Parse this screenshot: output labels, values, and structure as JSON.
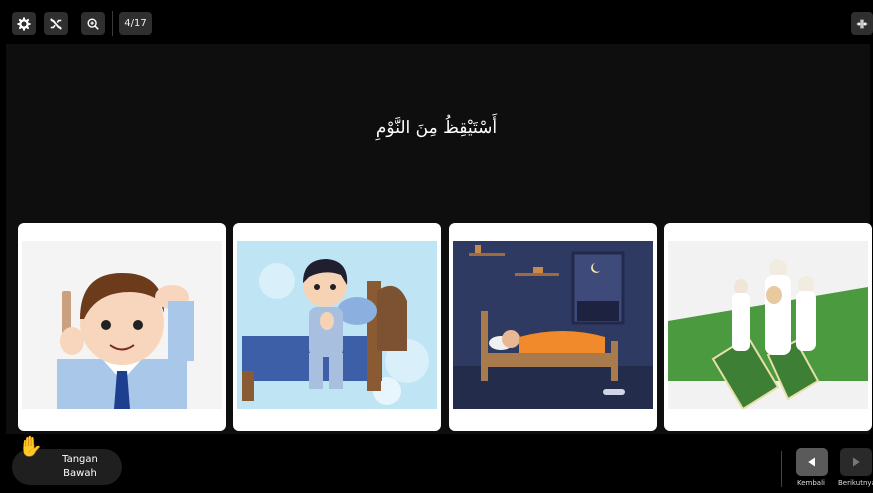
{
  "toolbar": {
    "settings_icon": "gear-icon",
    "shuffle_icon": "shuffle-off-icon",
    "zoom_icon": "zoom-in-icon",
    "slide_counter": "4/17",
    "collapse_icon": "collapse-icon"
  },
  "question": {
    "text": "أَسْتَيْقِظُ مِنَ النَّوْمِ"
  },
  "answer_cards": [
    {
      "image": "boy-combing-hair"
    },
    {
      "image": "boy-praying-on-bed"
    },
    {
      "image": "boy-sleeping-in-bed"
    },
    {
      "image": "family-praying-on-mats"
    }
  ],
  "raise_hand": {
    "icon": "raised-hand-icon",
    "label": "Tangan Bawah"
  },
  "navigation": {
    "back_label": "Kembali",
    "next_label": "Berikutnya"
  },
  "colors": {
    "background": "#000000",
    "stage": "#0e0e0e",
    "button": "#2f2f2f",
    "hand": "#f0a020"
  }
}
